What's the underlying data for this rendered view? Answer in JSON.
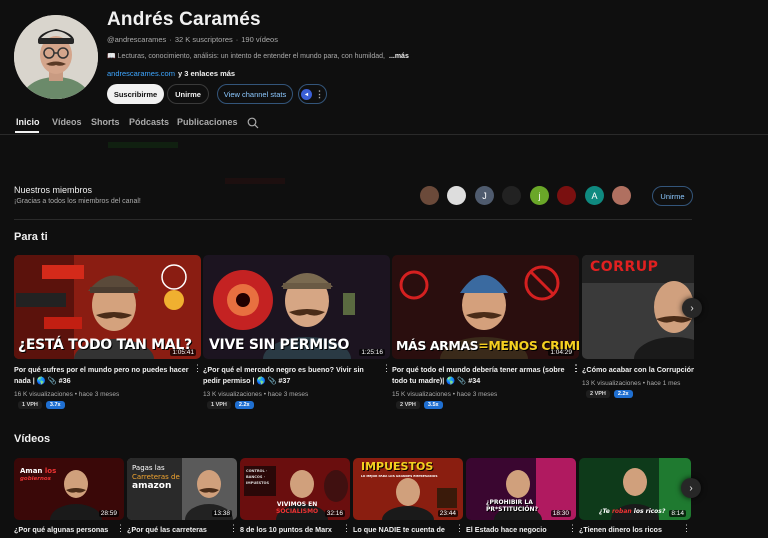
{
  "channel": {
    "name": "Andrés Caramés",
    "handle": "@andrescarames",
    "subscribers": "32 K suscriptores",
    "video_count": "190 vídeos",
    "description": "📖 Lecturas, conocimiento, análisis: un intento de entender el mundo para, con humildad,",
    "more_label": "...más",
    "link": "andrescarames.com",
    "extra_links": "y 3 enlaces más"
  },
  "buttons": {
    "subscribe": "Suscribirme",
    "unsubscribe": "Unirme",
    "stats": "View channel stats",
    "join": "Unirme"
  },
  "tabs": [
    "Inicio",
    "Vídeos",
    "Shorts",
    "Pódcasts",
    "Publicaciones"
  ],
  "members": {
    "title": "Nuestros miembros",
    "subtitle": "¡Gracias a todos los miembros del canal!",
    "avatars": [
      {
        "initial": "",
        "color": "#6b4a3a"
      },
      {
        "initial": "",
        "color": "#ddd"
      },
      {
        "initial": "J",
        "color": "#4f5b6e"
      },
      {
        "initial": "",
        "color": "#222"
      },
      {
        "initial": "j",
        "color": "#6aa728"
      },
      {
        "initial": "",
        "color": "#7a1010"
      },
      {
        "initial": "A",
        "color": "#0f8a80"
      },
      {
        "initial": "",
        "color": "#b07060"
      }
    ]
  },
  "para_ti": {
    "title": "Para ti",
    "videos": [
      {
        "title": "Por qué sufres por el mundo pero no puedes hacer nada | 🌎 📎 #36",
        "duration": "1:05:41",
        "views": "16 K visualizaciones",
        "age": "hace 3 meses",
        "vph": "1 VPH",
        "mult": "3.7x",
        "thumb_text": "¿ESTÁ TODO TAN MAL?"
      },
      {
        "title": "¿Por qué el mercado negro es bueno? Vivir sin pedir permiso | 🌎 📎 #37",
        "duration": "1:25:16",
        "views": "13 K visualizaciones",
        "age": "hace 3 meses",
        "vph": "1 VPH",
        "mult": "2.2x",
        "thumb_text": "VIVE SIN PERMISO"
      },
      {
        "title": "Por qué todo el mundo debería tener armas (sobre todo tu madre)| 🌎 📎 #34",
        "duration": "1:04:29",
        "views": "15 K visualizaciones",
        "age": "hace 3 meses",
        "vph": "2 VPH",
        "mult": "3.5x",
        "thumb_text_a": "MÁS ARMAS",
        "thumb_text_b": "=MENOS CRIMEN"
      },
      {
        "title": "¿Cómo acabar con la Corrupción?",
        "duration": "",
        "views": "13 K visualizaciones",
        "age": "hace 1 mes",
        "vph": "2 VPH",
        "mult": "2.2x",
        "thumb_text": "CORRUP"
      }
    ]
  },
  "videos_section": {
    "title": "Vídeos",
    "videos": [
      {
        "title": "¿Por qué algunas personas",
        "duration": "28:59",
        "thumb_text_a": "Aman",
        "thumb_text_b": "los",
        "thumb_text_c": "gobiernos"
      },
      {
        "title": "¿Por qué las carreteras",
        "duration": "13:38",
        "thumb_text_a": "Pagas las",
        "thumb_text_b": "Carreteras de",
        "thumb_text_c": "amazon"
      },
      {
        "title": "8 de los 10 puntos de Marx",
        "duration": "32:16",
        "thumb_text_a": "VIVIMOS EN",
        "thumb_text_b": "SOCIALISMO",
        "thumb_text_c": "CONTROL · BANCOS · IMPUESTOS"
      },
      {
        "title": "Lo que NADIE te cuenta de",
        "duration": "23:44",
        "thumb_text_a": "IMPUESTOS",
        "thumb_text_b": "LO MEJOR PARA LOS GRANDES EMPRESARIOS"
      },
      {
        "title": "El Estado hace negocio",
        "duration": "18:30",
        "thumb_text_a": "¿PROHIBIR LA",
        "thumb_text_b": "PR*STITUCIÓN?"
      },
      {
        "title": "¿Tienen dinero los ricos",
        "duration": "8:14",
        "thumb_text_a": "¿Te",
        "thumb_text_b": "roban",
        "thumb_text_c": "los ricos?"
      }
    ]
  }
}
